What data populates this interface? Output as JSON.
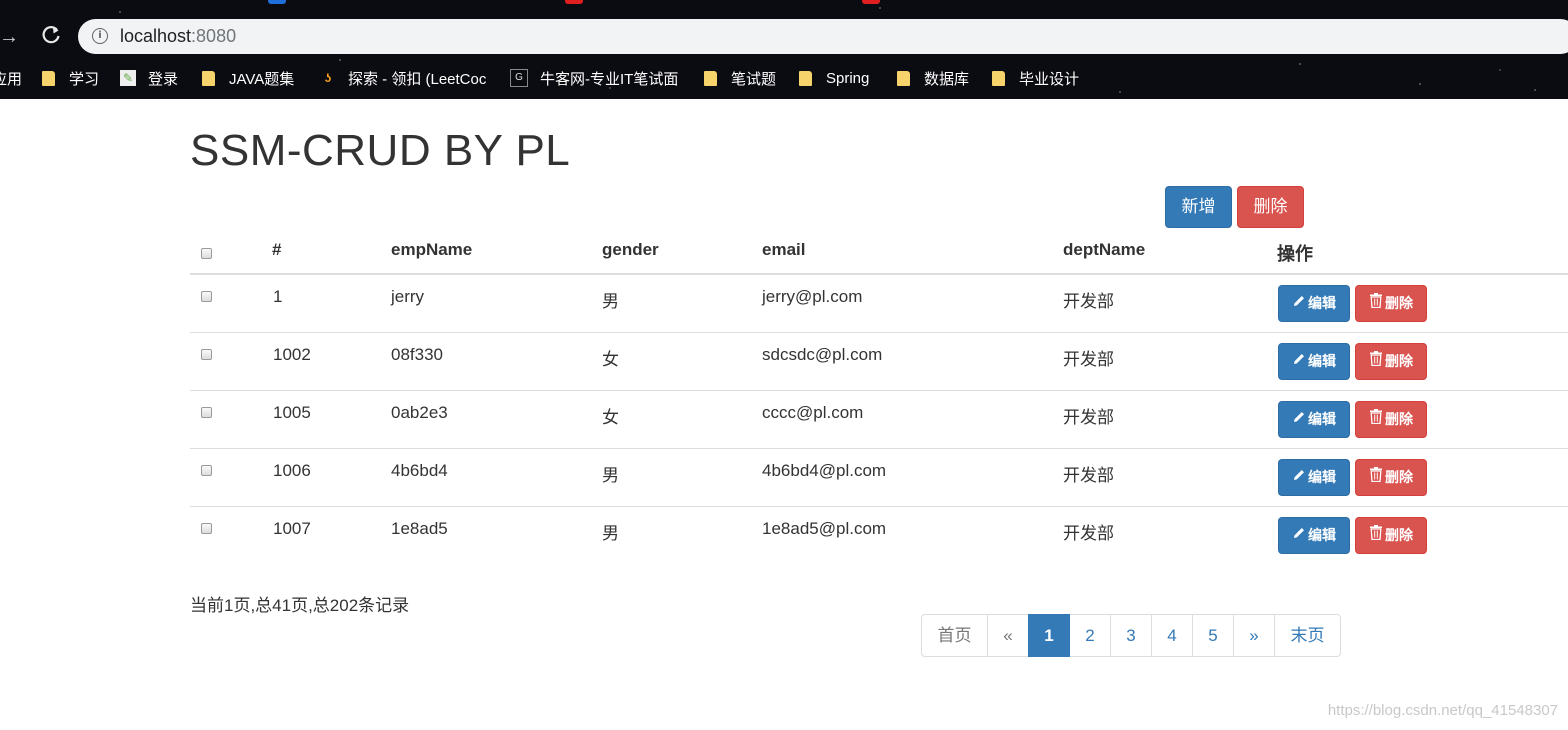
{
  "browser": {
    "url_host": "localhost",
    "url_port": ":8080",
    "bookmarks": [
      {
        "label": "应用",
        "icon": "apps-icon"
      },
      {
        "label": "学习",
        "icon": "folder-icon"
      },
      {
        "label": "登录",
        "icon": "favicon-icon"
      },
      {
        "label": "JAVA题集",
        "icon": "folder-icon"
      },
      {
        "label": "探索 - 领扣 (LeetCoc",
        "icon": "leetcode-icon"
      },
      {
        "label": "牛客网-专业IT笔试面",
        "icon": "nowcoder-icon"
      },
      {
        "label": "笔试题",
        "icon": "folder-icon"
      },
      {
        "label": "Spring",
        "icon": "folder-icon"
      },
      {
        "label": "数据库",
        "icon": "folder-icon"
      },
      {
        "label": "毕业设计",
        "icon": "folder-icon"
      }
    ]
  },
  "page": {
    "title": "SSM-CRUD BY PL",
    "add_label": "新增",
    "delete_label": "删除"
  },
  "table": {
    "columns": [
      "#",
      "empName",
      "gender",
      "email",
      "deptName",
      "操作"
    ],
    "rows": [
      {
        "id": "1",
        "empName": "jerry",
        "gender": "男",
        "email": "jerry@pl.com",
        "deptName": "开发部"
      },
      {
        "id": "1002",
        "empName": "08f330",
        "gender": "女",
        "email": "sdcsdc@pl.com",
        "deptName": "开发部"
      },
      {
        "id": "1005",
        "empName": "0ab2e3",
        "gender": "女",
        "email": "cccc@pl.com",
        "deptName": "开发部"
      },
      {
        "id": "1006",
        "empName": "4b6bd4",
        "gender": "男",
        "email": "4b6bd4@pl.com",
        "deptName": "开发部"
      },
      {
        "id": "1007",
        "empName": "1e8ad5",
        "gender": "男",
        "email": "1e8ad5@pl.com",
        "deptName": "开发部"
      }
    ],
    "edit_label": "编辑",
    "row_delete_label": "删除"
  },
  "pagination": {
    "info": "当前1页,总41页,总202条记录",
    "first": "首页",
    "prev": "«",
    "pages": [
      "1",
      "2",
      "3",
      "4",
      "5"
    ],
    "active": "1",
    "next": "»",
    "last": "末页"
  },
  "watermark": "https://blog.csdn.net/qq_41548307",
  "colors": {
    "primary": "#337ab7",
    "danger": "#d9534f"
  }
}
